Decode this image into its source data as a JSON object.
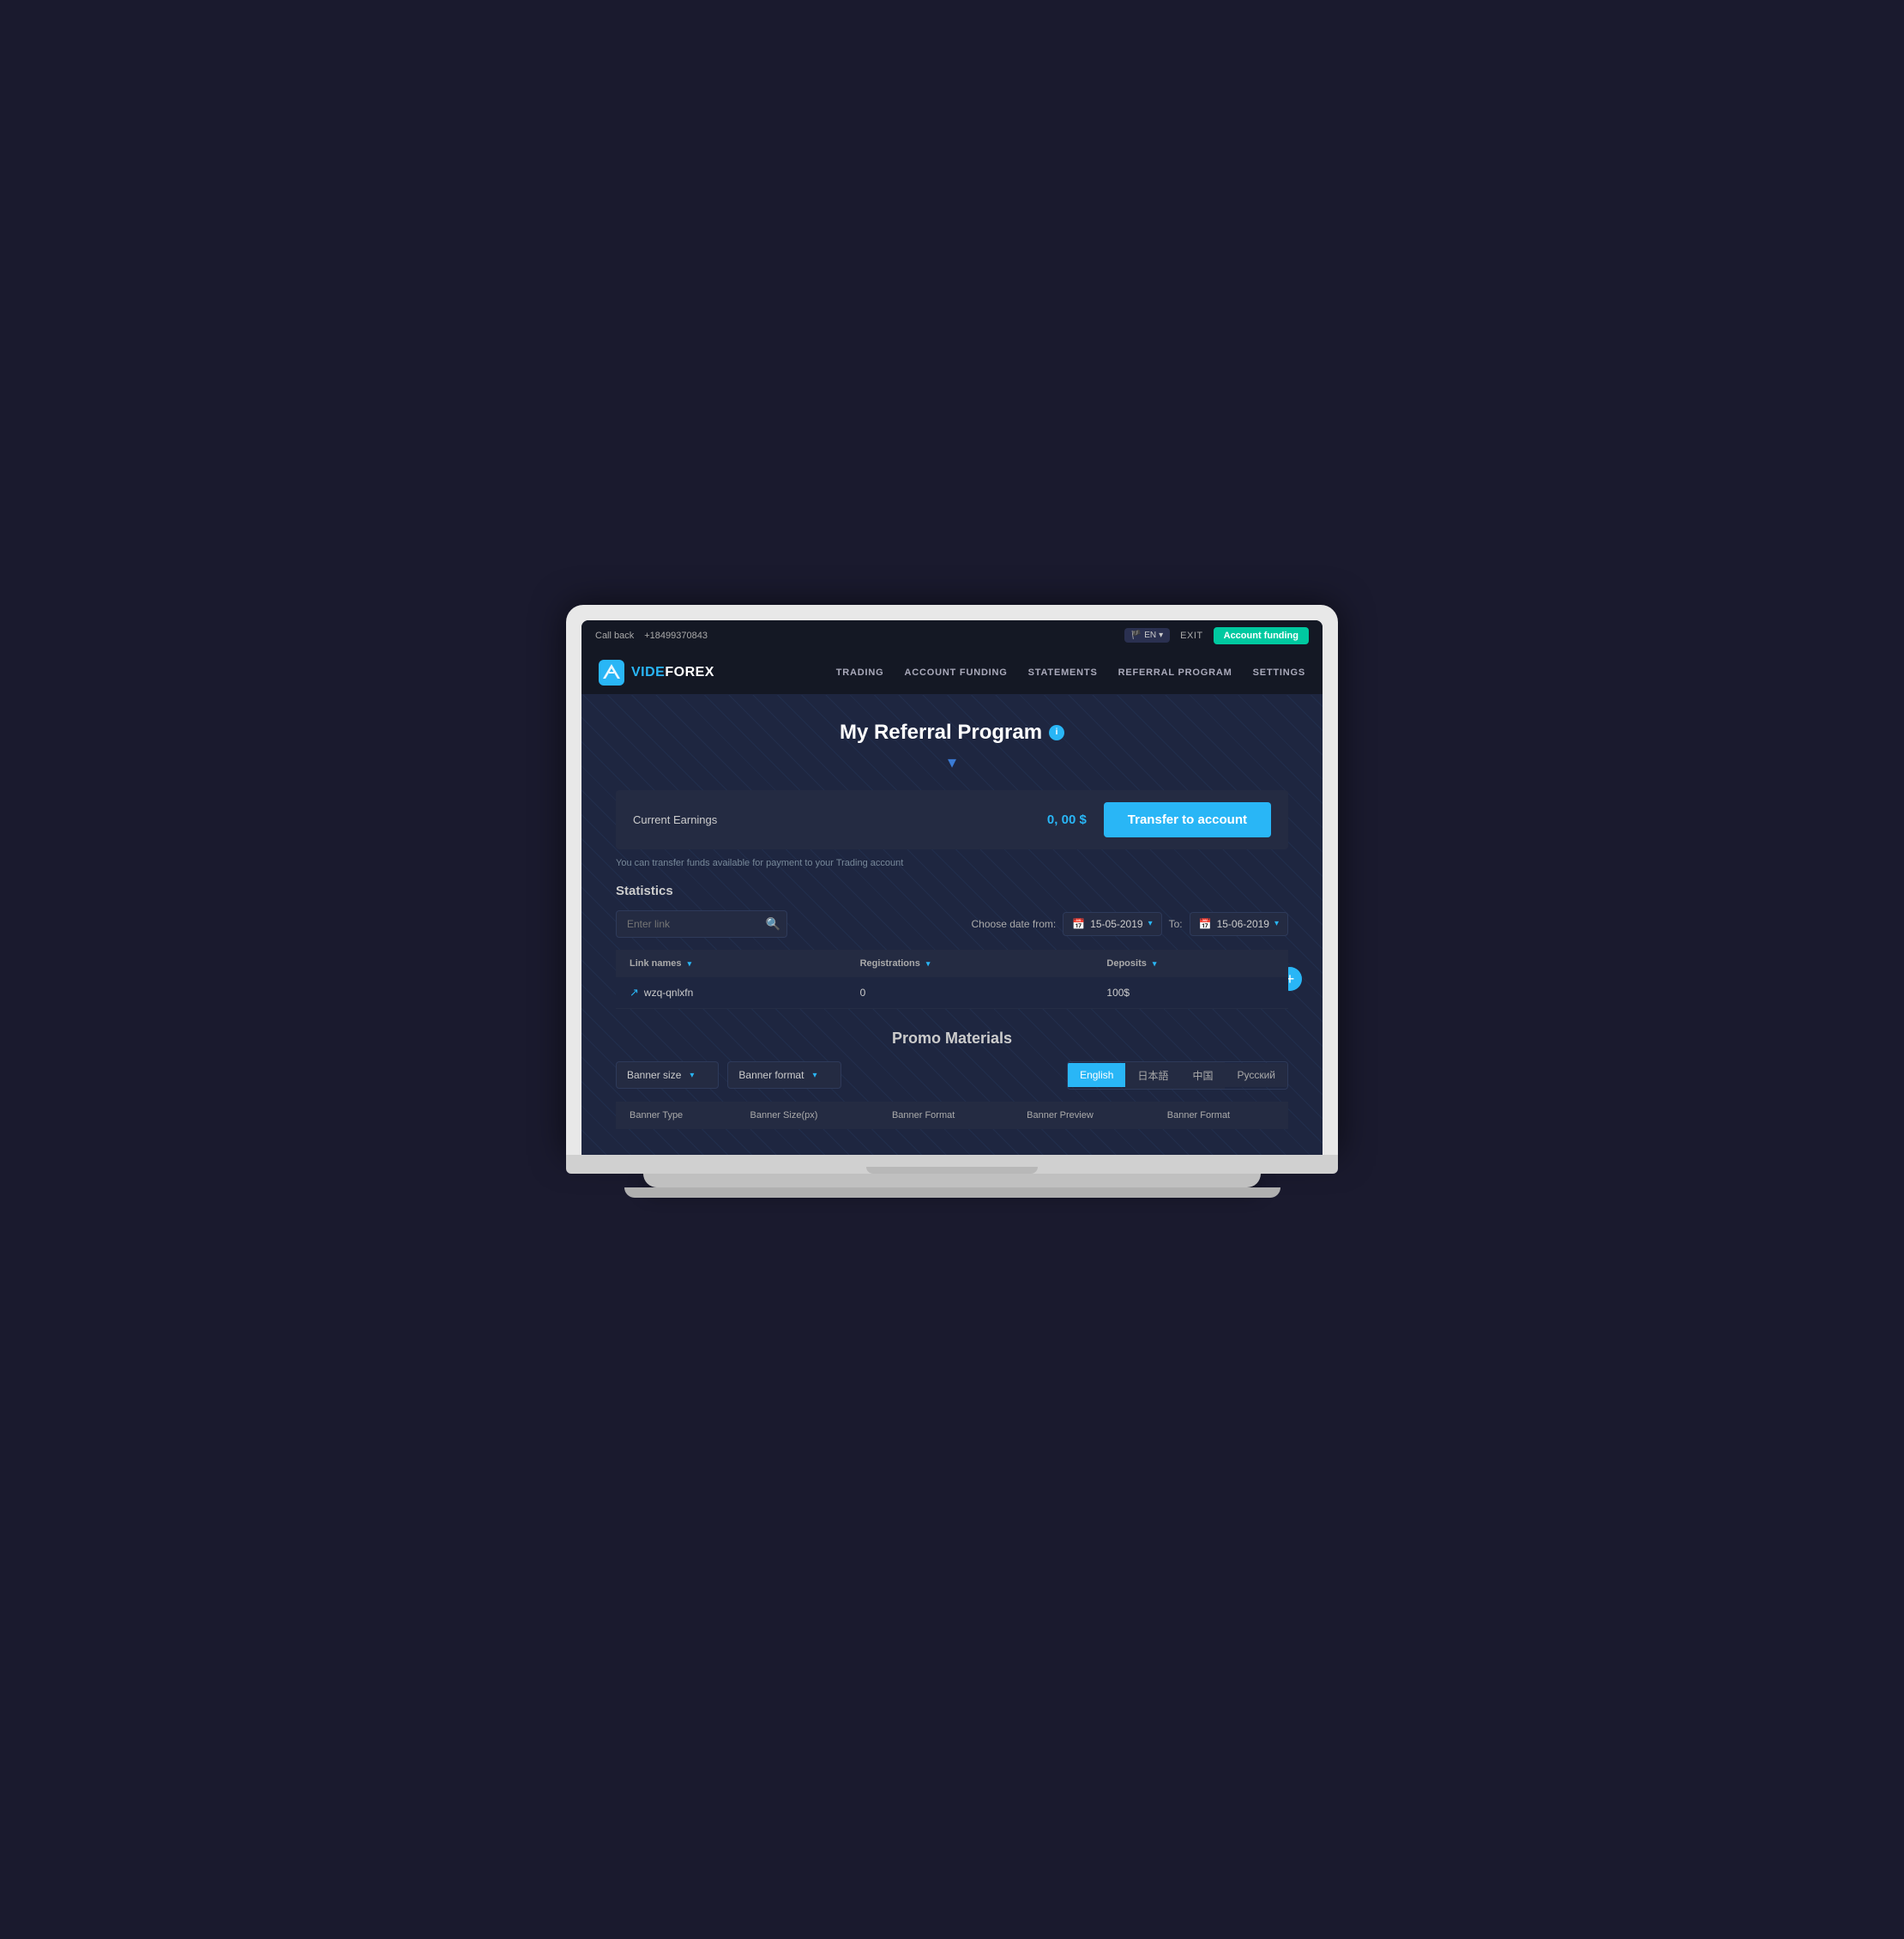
{
  "topbar": {
    "callback_label": "Call back",
    "phone": "+18499370843",
    "lang_label": "EN",
    "exit_label": "EXIT",
    "account_funding_btn": "Account funding"
  },
  "nav": {
    "logo_text_vide": "VIDE",
    "logo_text_forex": "FOREX",
    "links": [
      {
        "label": "TRADING",
        "id": "trading"
      },
      {
        "label": "ACCOUNT FUNDING",
        "id": "account-funding"
      },
      {
        "label": "STATEMENTS",
        "id": "statements"
      },
      {
        "label": "REFERRAL PROGRAM",
        "id": "referral"
      },
      {
        "label": "SETTINGS",
        "id": "settings"
      }
    ]
  },
  "page": {
    "title": "My Referral Program",
    "chevron": "▾",
    "earnings_label": "Current Earnings",
    "earnings_value": "0, 00 $",
    "transfer_btn": "Transfer to account",
    "transfer_note": "You can transfer funds available for payment to your Trading account",
    "statistics_label": "Statistics",
    "search_placeholder": "Enter link",
    "date_from_label": "Choose date from:",
    "date_from_value": "15-05-2019",
    "date_to_label": "To:",
    "date_to_value": "15-06-2019",
    "table_headers": [
      {
        "label": "Link names",
        "sortable": true
      },
      {
        "label": "Registrations",
        "sortable": true
      },
      {
        "label": "Deposits",
        "sortable": true
      }
    ],
    "table_rows": [
      {
        "link": "wzq-qnlxfn",
        "registrations": "0",
        "deposits": "100$"
      }
    ],
    "promo_title": "Promo Materials",
    "banner_size_label": "Banner size",
    "banner_format_label": "Banner format",
    "lang_tabs": [
      {
        "label": "English",
        "active": true
      },
      {
        "label": "日本語",
        "active": false
      },
      {
        "label": "中国",
        "active": false
      },
      {
        "label": "Русский",
        "active": false
      }
    ],
    "banner_table_headers": [
      "Banner Type",
      "Banner Size(px)",
      "Banner Format",
      "Banner Preview",
      "Banner Format"
    ]
  },
  "colors": {
    "accent": "#29b6f6",
    "success": "#00c9a0",
    "bg_dark": "#141824",
    "bg_medium": "#1e2640",
    "bg_card": "#242b42"
  }
}
